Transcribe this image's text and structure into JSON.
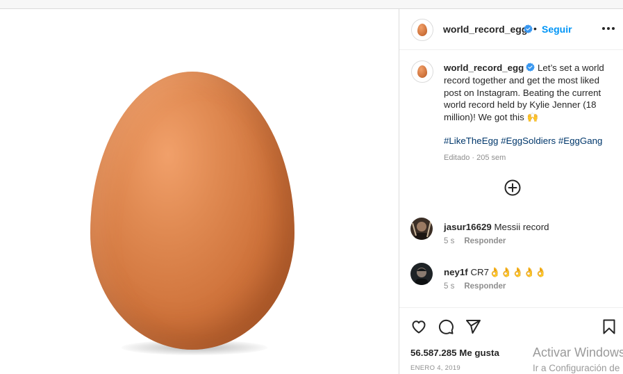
{
  "post": {
    "username": "world_record_egg",
    "follow_label": "Seguir",
    "separator": "•",
    "caption": "Let’s set a world record together and get the most liked post on Instagram. Beating the current world record held by Kylie Jenner (18 million)! We got this 🙌",
    "hashtags": [
      "#LikeTheEgg",
      "#EggSoldiers",
      "#EggGang"
    ],
    "edited_label": "Editado · 205 sem",
    "likes_label": "56.587.285 Me gusta",
    "date_label": "ENERO 4, 2019"
  },
  "comments": [
    {
      "user": "jasur16629",
      "text": "Messii record",
      "time": "5 s",
      "reply_label": "Responder"
    },
    {
      "user": "ney1f",
      "text": "CR7👌👌👌👌👌",
      "time": "5 s",
      "reply_label": "Responder"
    }
  ],
  "icons": {
    "verified": "verified-badge-icon",
    "more": "more-options-icon",
    "add_comment": "plus-circle-icon",
    "like": "heart-icon",
    "comment": "comment-bubble-icon",
    "share": "paper-plane-icon",
    "save": "bookmark-icon"
  },
  "watermark": {
    "line1": "Activar Windows",
    "line2": "Ir a Configuración de"
  },
  "colors": {
    "accent": "#0095f6",
    "hashtag": "#00376b",
    "muted": "#8e8e8e",
    "verified": "#3897f0"
  }
}
